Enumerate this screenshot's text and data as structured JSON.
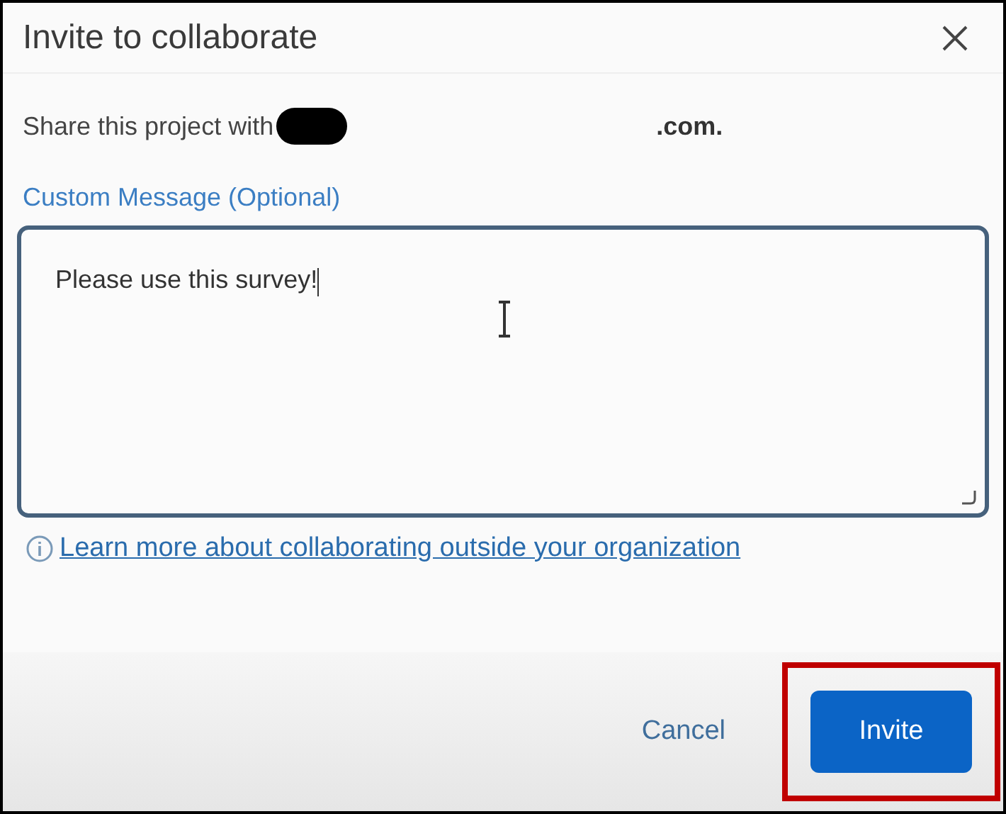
{
  "dialog": {
    "title": "Invite to collaborate"
  },
  "share": {
    "prefix": "Share this project with",
    "redacted": true,
    "suffix": ".com."
  },
  "message": {
    "label": "Custom Message (Optional)",
    "value": "Please use this survey!"
  },
  "help_link": "Learn more about collaborating outside your organization",
  "buttons": [
    {
      "label": "Cancel",
      "kind": "secondary",
      "highlighted": false
    },
    {
      "label": "Invite",
      "kind": "primary",
      "highlighted": true
    }
  ]
}
